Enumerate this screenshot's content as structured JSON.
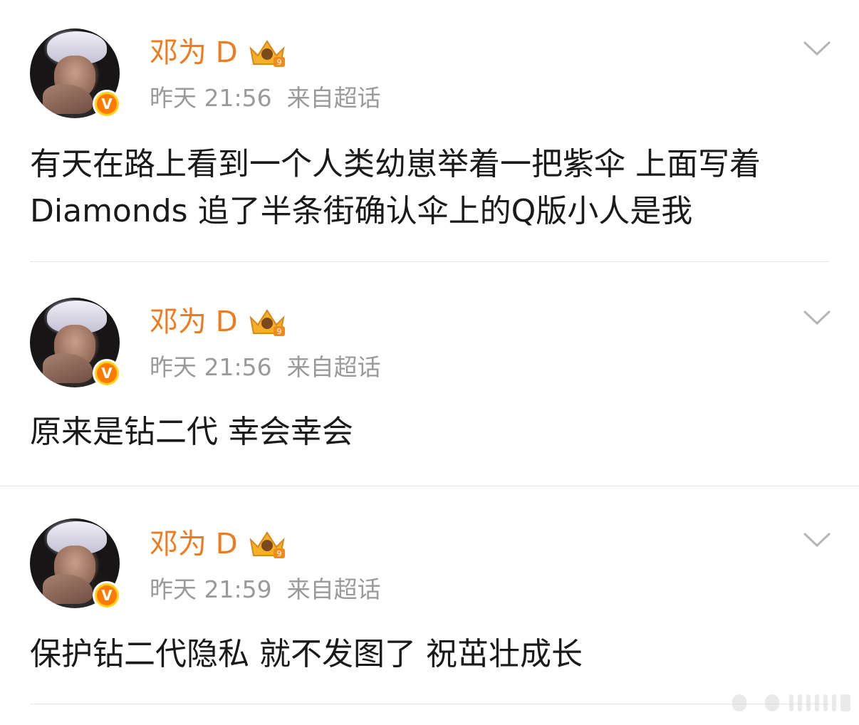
{
  "posts": [
    {
      "author": "邓为 D",
      "time": "昨天 21:56",
      "source": "来自超话",
      "badge": "V",
      "crown_level": "9",
      "content": "有天在路上看到一个人类幼崽举着一把紫伞 上面写着 Diamonds 追了半条街确认伞上的Q版小人是我"
    },
    {
      "author": "邓为 D",
      "time": "昨天 21:56",
      "source": "来自超话",
      "badge": "V",
      "crown_level": "9",
      "content": "原来是钻二代  幸会幸会"
    },
    {
      "author": "邓为 D",
      "time": "昨天 21:59",
      "source": "来自超话",
      "badge": "V",
      "crown_level": "9",
      "content": "保护钻二代隐私  就不发图了  祝茁壮成长"
    }
  ],
  "icons": {
    "more": "chevron-down-icon",
    "crown": "crown-icon",
    "verified": "verified-badge-icon"
  },
  "colors": {
    "author": "#f07a1e",
    "meta": "#9a9a9a",
    "content": "#1a1a1a",
    "badge_outer": "#ffd11a",
    "badge_inner": "#ff7a00",
    "divider": "#e6e6e6"
  }
}
